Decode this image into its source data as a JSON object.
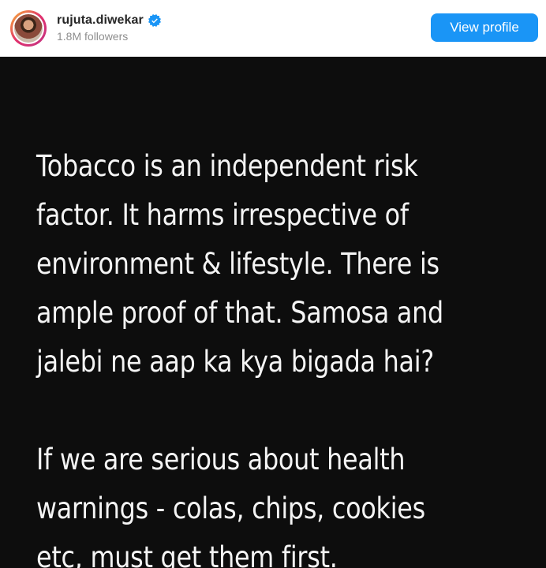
{
  "profile": {
    "username": "rujuta.diwekar",
    "followers": "1.8M followers",
    "verified_icon": "verified-badge-icon",
    "view_profile_label": "View profile"
  },
  "post": {
    "paragraph1": [
      "Tobacco is an independent risk",
      "factor. It harms irrespective of",
      "environment & lifestyle. There is",
      "ample proof of that. Samosa and",
      "jalebi ne aap ka kya bigada hai?"
    ],
    "paragraph2": [
      "If we are serious about health",
      "warnings - colas, chips, cookies",
      "etc, must get them first."
    ]
  },
  "colors": {
    "button": "#1a95f6",
    "post_background": "#0d0d0d",
    "verified": "#1a95f6"
  }
}
